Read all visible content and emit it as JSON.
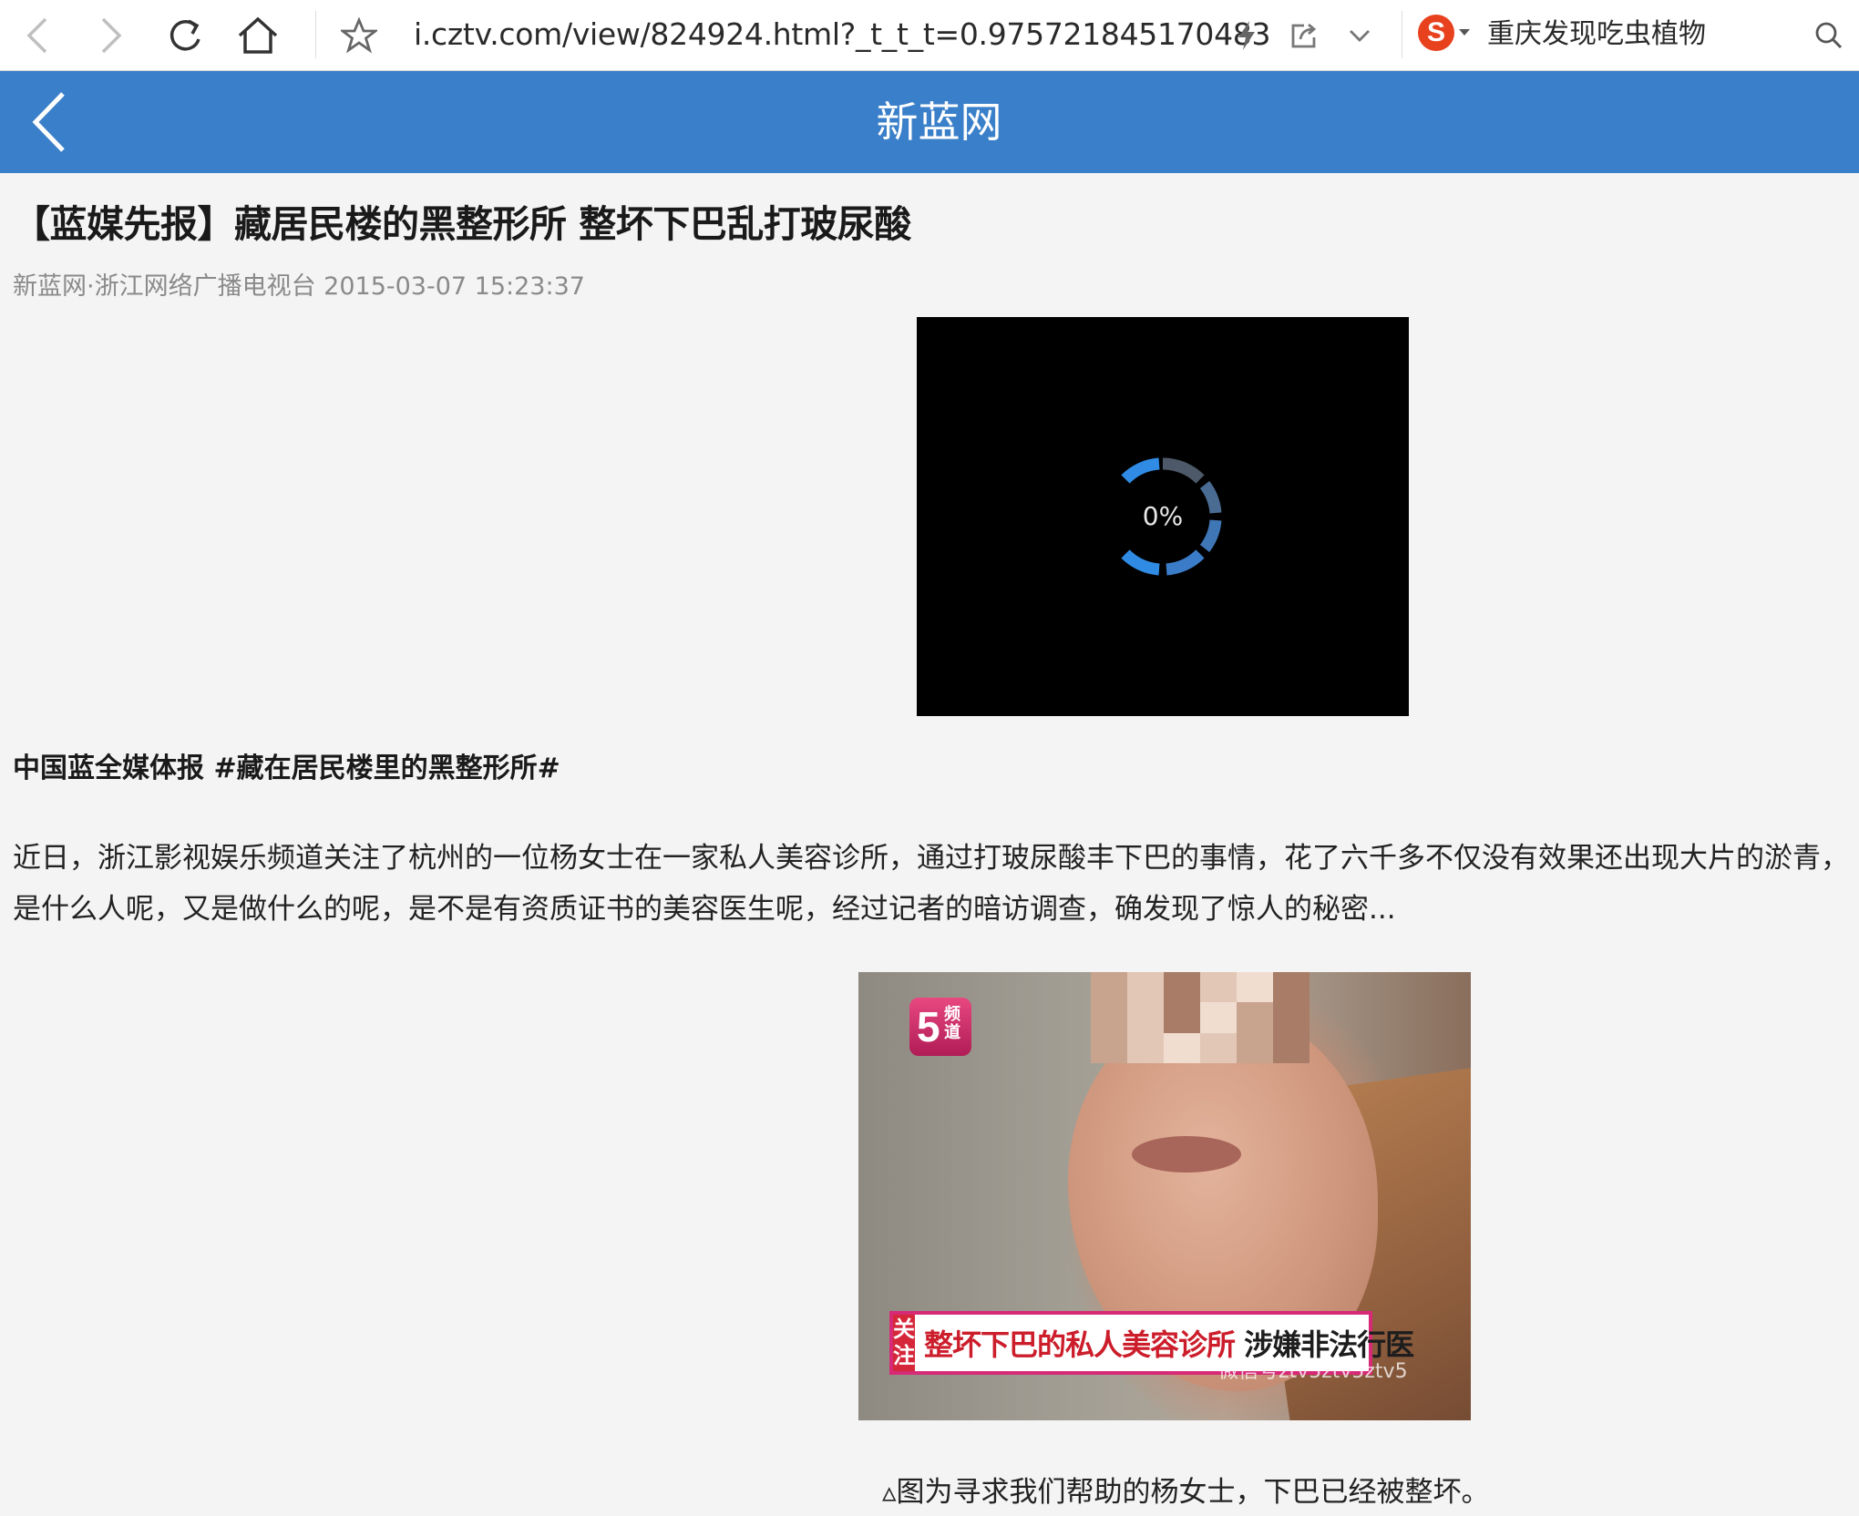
{
  "browser": {
    "url": "i.cztv.com/view/824924.html?_t_t_t=0.975721845170483",
    "search_engine_glyph": "S",
    "search_query": "重庆发现吃虫植物",
    "icons": [
      "back-arrow-icon",
      "forward-arrow-icon",
      "reload-icon",
      "home-icon",
      "star-icon",
      "lightning-icon",
      "share-icon",
      "chevron-down-icon",
      "search-icon"
    ]
  },
  "site": {
    "title": "新蓝网",
    "header_color": "#3a7fc9"
  },
  "article": {
    "title": "【蓝媒先报】藏居民楼的黑整形所 整坏下巴乱打玻尿酸",
    "meta": "新蓝网·浙江网络广播电视台 2015-03-07 15:23:37",
    "video": {
      "loading_label": "0%",
      "progress": 0
    },
    "hashtag": "中国蓝全媒体报 #藏在居民楼里的黑整形所#",
    "paragraph_lines": [
      "近日，浙江影视娱乐频道关注了杭州的一位杨女士在一家私人美容诊所，通过打玻尿酸丰下巴的事情，花了六千多不仅没有效果还出现大片的淤青，",
      "是什么人呢，又是做什么的呢，是不是有资质证书的美容医生呢，经过记者的暗访调查，确发现了惊人的秘密..."
    ],
    "image": {
      "channel_logo_number": "5",
      "channel_logo_text": "频道",
      "caption_tag": "关注",
      "caption_red": "整坏下巴的私人美容诊所",
      "caption_black": "涉嫌非法行医",
      "watermark": "微信号ztv5ztv5ztv5"
    },
    "figure_caption": "▵图为寻求我们帮助的杨女士，下巴已经被整坏。"
  }
}
